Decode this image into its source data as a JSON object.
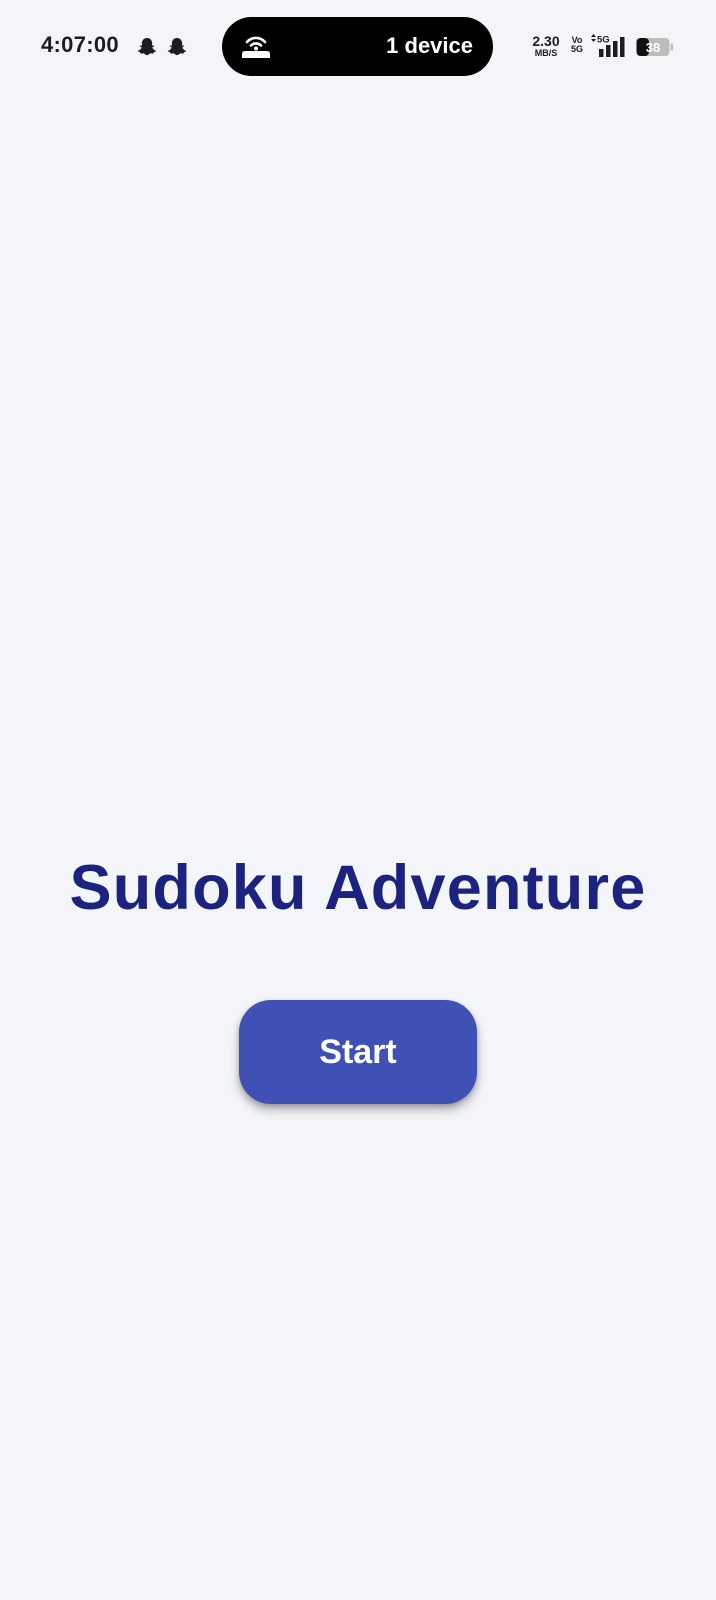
{
  "status_bar": {
    "time": "4:07:00",
    "notification_icons": [
      "snapchat-icon",
      "snapchat-icon"
    ],
    "hotspot": {
      "icon": "hotspot-icon",
      "label": "1 device"
    },
    "network_speed": {
      "value": "2.30",
      "unit": "MB/S"
    },
    "volte": {
      "line1": "Vo",
      "line2": "5G"
    },
    "network_type": "5G",
    "battery": {
      "level": "38"
    }
  },
  "main": {
    "title": "Sudoku Adventure",
    "start_button_label": "Start"
  },
  "colors": {
    "background": "#f4f5f9",
    "title": "#1b237e",
    "button": "#3f51b5",
    "button_text": "#ffffff"
  }
}
